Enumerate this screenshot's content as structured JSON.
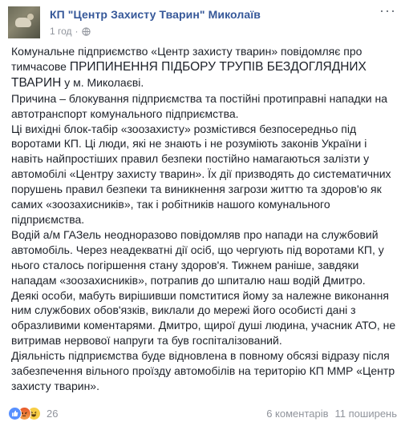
{
  "post": {
    "page_name": "КП \"Центр Захисту Тварин\" Миколаїв",
    "time": "1 год",
    "separator": "·",
    "paragraphs": [
      {
        "lead": "Комунальне підприємство «Центр захисту тварин» повідомляє про тимчасове ",
        "caps": "ПРИПИНЕННЯ ПІДБОРУ ТРУПІВ БЕЗДОГЛЯДНИХ ТВАРИН",
        "tail": " у м. Миколаєві."
      }
    ],
    "text_lines": [
      "Причина – блокування підприємства та постійні протиправні нападки на автотранспорт комунального підприємства.",
      "Ці вихідні блок-табір «зоозахисту» розмістився безпосередньо під воротами КП. Ці люди, які не знають і не розуміють законів України і навіть найпростіших правил безпеки постійно намагаються залізти у автомобілі «Центру захисту тварин». Їх дії призводять до систематичних порушень правил безпеки та виникнення загрози життю та здоров'ю як самих «зоозахисників», так і робітників нашого комунального підприємства.",
      "Водій а/м ГАЗель неодноразово повідомляв про напади на службовий автомобіль. Через неадекватні дії осіб, що чергують під воротами КП, у нього сталось погіршення стану здоров'я. Тижнем раніше, завдяки нападам «зоозахисників», потрапив до шпиталю наш водій Дмитро.",
      "Деякі особи, мабуть вирішивши помститися йому за належне виконання ним службових обов'язків, виклали до мережі його особисті дані з образливими коментарями. Дмитро, щирої душі людина, учасник АТО, не витримав нервової напруги та був госпіталізований.",
      "Діяльність підприємства буде відновлена в повному обсязі відразу після забезпечення вільного проїзду автомобілів на територію КП ММР «Центр захисту тварин»."
    ]
  },
  "footer": {
    "reaction_count": "26",
    "comments": "6 коментарів",
    "shares": "11 поширень"
  },
  "icons": {
    "avatar": "dog-photo-avatar",
    "audience": "globe-icon",
    "menu": "more-options-icon",
    "reactions": [
      "like-reaction-icon",
      "angry-reaction-icon",
      "haha-reaction-icon"
    ]
  },
  "colors": {
    "page_name": "#365899",
    "text": "#1d2129",
    "meta": "#90949c"
  }
}
